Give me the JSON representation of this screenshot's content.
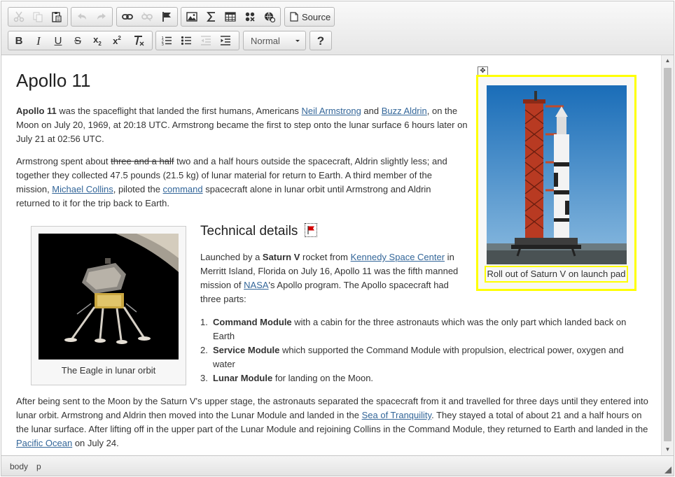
{
  "toolbar": {
    "row1": [
      {
        "name": "cut-button",
        "icon": "scissors-icon",
        "disabled": true
      },
      {
        "name": "copy-button",
        "icon": "copy-icon",
        "disabled": true
      },
      {
        "name": "paste-button",
        "icon": "clipboard-icon",
        "disabled": false
      },
      {
        "name": "undo-button",
        "icon": "undo-icon",
        "disabled": true
      },
      {
        "name": "redo-button",
        "icon": "redo-icon",
        "disabled": true
      },
      {
        "name": "link-button",
        "icon": "link-icon",
        "disabled": false
      },
      {
        "name": "unlink-button",
        "icon": "unlink-icon",
        "disabled": true
      },
      {
        "name": "anchor-button",
        "icon": "flag-icon",
        "disabled": false
      },
      {
        "name": "image-button",
        "icon": "image-icon",
        "disabled": false
      },
      {
        "name": "math-button",
        "icon": "sigma-icon",
        "disabled": false
      },
      {
        "name": "table-button",
        "icon": "table-icon",
        "disabled": false
      },
      {
        "name": "special-char-button",
        "icon": "omega-icon",
        "disabled": false
      },
      {
        "name": "globe-button",
        "icon": "globe-icon",
        "disabled": false
      }
    ],
    "source_label": "Source",
    "format_value": "Normal",
    "help_label": "?"
  },
  "article": {
    "title": "Apollo 11",
    "p1": {
      "bold_start": "Apollo 11",
      "t1": " was the spaceflight that landed the first humans, Americans ",
      "link1": "Neil Armstrong",
      "t2": " and ",
      "link2": "Buzz Aldrin",
      "t3": ", on the Moon on July 20, 1969, at 20:18 UTC. Armstrong became the first to step onto the lunar surface 6 hours later on July 21 at 02:56 UTC."
    },
    "p2": {
      "t1": "Armstrong spent about ",
      "struck": "three and a half",
      "t2": " two and a half hours outside the spacecraft, Aldrin slightly less; and together they collected 47.5 pounds (21.5 kg) of lunar material for return to Earth. A third member of the mission, ",
      "link1": "Michael Collins",
      "t3": ", piloted the ",
      "link2": "command",
      "t4": " spacecraft alone in lunar orbit until Armstrong and Aldrin returned to it for the trip back to Earth."
    },
    "figure_eagle_caption": "The Eagle in lunar orbit",
    "figure_saturn_caption": "Roll out of Saturn V on launch pad",
    "h2": "Technical details",
    "p3": {
      "t1": "Launched by a ",
      "bold": "Saturn V",
      "t2": " rocket from ",
      "link1": "Kennedy Space Center",
      "t3": " in Merritt Island, Florida on July 16, Apollo 11 was the fifth manned mission of ",
      "link2": "NASA",
      "t4": "'s Apollo program. The Apollo spacecraft had three parts:"
    },
    "parts": [
      {
        "num": "1.",
        "bold": "Command Module",
        "text": " with a cabin for the three astronauts which was the only part which landed back on Earth"
      },
      {
        "num": "2.",
        "bold": "Service Module",
        "text": " which supported the Command Module with propulsion, electrical power, oxygen and water"
      },
      {
        "num": "3.",
        "bold": "Lunar Module",
        "text": " for landing on the Moon."
      }
    ],
    "p4": {
      "t1": "After being sent to the Moon by the Saturn V's upper stage, the astronauts separated the spacecraft from it and travelled for three days until they entered into lunar orbit. Armstrong and Aldrin then moved into the Lunar Module and landed in the ",
      "link1": "Sea of Tranquility",
      "t2": ". They stayed a total of about 21 and a half hours on the lunar surface. After lifting off in the upper part of the Lunar Module and rejoining Collins in the Command Module, they returned to Earth and landed in the ",
      "link2": "Pacific Ocean",
      "t3": " on July 24."
    }
  },
  "statusbar": {
    "path": [
      "body",
      "p"
    ]
  },
  "colors": {
    "link": "#336699",
    "selection": "#ffff00",
    "toolbar_bg": "#e6e6e6"
  }
}
